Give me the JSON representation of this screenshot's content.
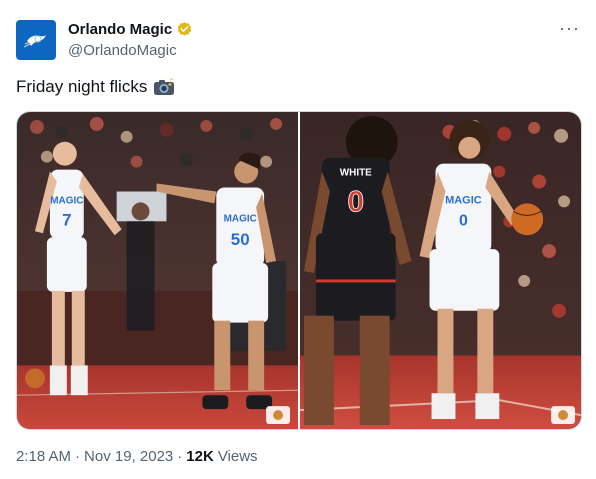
{
  "author": {
    "display_name": "Orlando Magic",
    "handle": "@OrlandoMagic",
    "verified_badge_color": "#e2b719",
    "avatar_color": "#0d67c0"
  },
  "tweet": {
    "text": "Friday night flicks",
    "emoji_icon": "camera-flash-icon"
  },
  "media": {
    "photos": [
      {
        "jersey_number_left": "7",
        "jersey_number_right": "50",
        "jersey_word": "MAGIC"
      },
      {
        "opponent_name": "WHITE",
        "opponent_number": "0",
        "player_number": "0",
        "jersey_word": "MAGIC"
      }
    ]
  },
  "meta": {
    "time": "2:18 AM",
    "separator": "·",
    "date": "Nov 19, 2023",
    "views_count": "12K",
    "views_label": "Views"
  },
  "colors": {
    "text_primary": "#0f1419",
    "text_secondary": "#536471",
    "court": "#b5342a",
    "magic_white": "#f4f6f9",
    "magic_blue": "#2a6fd1",
    "opponent_black": "#1c1c20",
    "opponent_red": "#d23b2f"
  }
}
